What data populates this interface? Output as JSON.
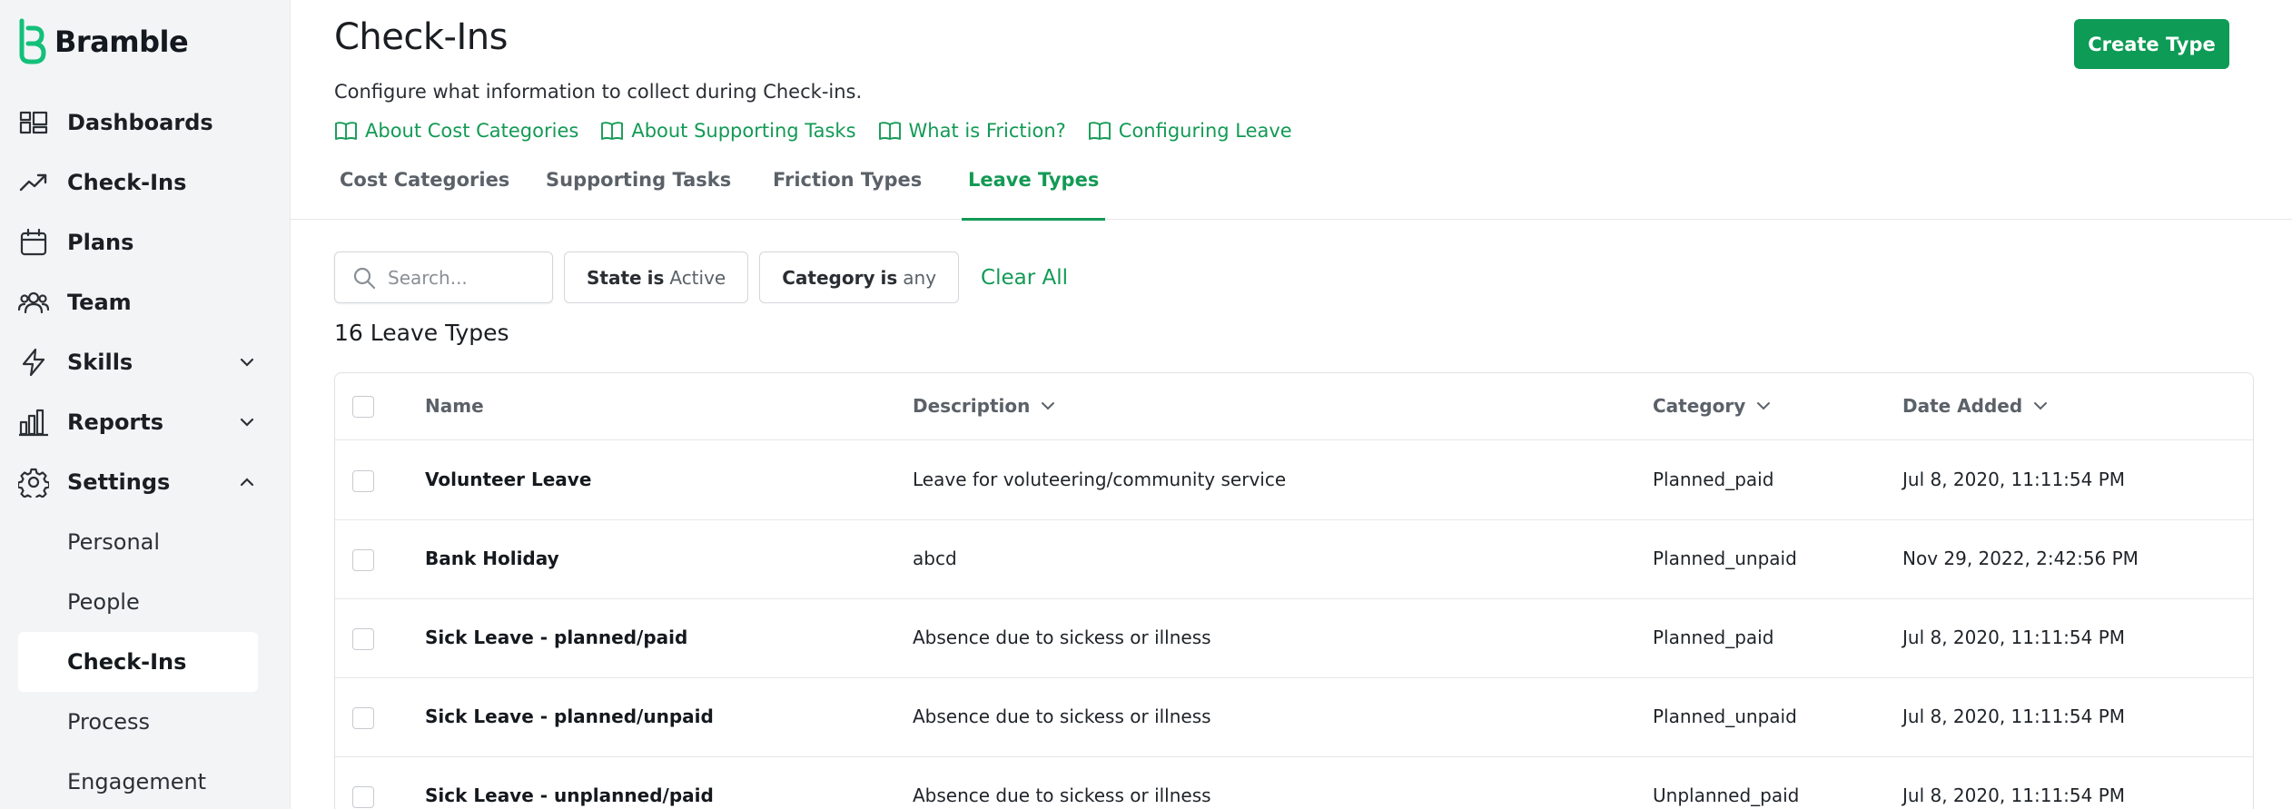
{
  "app": {
    "name": "Bramble",
    "accent": "#139a55",
    "button_color": "#0d9b55"
  },
  "sidebar": {
    "items": [
      {
        "key": "dashboards",
        "label": "Dashboards",
        "icon": "dashboard-icon"
      },
      {
        "key": "check-ins",
        "label": "Check-Ins",
        "icon": "trending-up-icon"
      },
      {
        "key": "plans",
        "label": "Plans",
        "icon": "calendar-icon"
      },
      {
        "key": "team",
        "label": "Team",
        "icon": "users-icon"
      },
      {
        "key": "skills",
        "label": "Skills",
        "icon": "lightning-icon",
        "chevron": "down"
      },
      {
        "key": "reports",
        "label": "Reports",
        "icon": "bar-chart-icon",
        "chevron": "down"
      },
      {
        "key": "settings",
        "label": "Settings",
        "icon": "gear-icon",
        "chevron": "up"
      }
    ],
    "settings_sub": [
      "Personal",
      "People",
      "Check-Ins",
      "Process",
      "Engagement"
    ],
    "active_sub": "Check-Ins"
  },
  "header": {
    "title": "Check-Ins",
    "subtitle": "Configure what information to collect during Check-ins.",
    "create_button": "Create Type",
    "help_links": [
      "About Cost Categories",
      "About Supporting Tasks",
      "What is Friction?",
      "Configuring Leave"
    ]
  },
  "tabs": [
    {
      "label": "Cost Categories",
      "active": false
    },
    {
      "label": "Supporting Tasks",
      "active": false
    },
    {
      "label": "Friction Types",
      "active": false
    },
    {
      "label": "Leave Types",
      "active": true
    }
  ],
  "filters": {
    "search_placeholder": "Search...",
    "state": {
      "key": "State",
      "op": "is",
      "value": "Active"
    },
    "category": {
      "key": "Category",
      "op": "is",
      "value": "any"
    },
    "clear_all": "Clear All"
  },
  "count_label": "16 Leave Types",
  "table": {
    "columns": [
      {
        "label": "Name",
        "sortable": false
      },
      {
        "label": "Description",
        "sortable": true
      },
      {
        "label": "Category",
        "sortable": true
      },
      {
        "label": "Date Added",
        "sortable": true
      }
    ],
    "rows": [
      {
        "name": "Volunteer Leave",
        "description": "Leave for voluteering/community service",
        "category": "Planned_paid",
        "date": "Jul 8, 2020, 11:11:54 PM"
      },
      {
        "name": "Bank Holiday",
        "description": "abcd",
        "category": "Planned_unpaid",
        "date": "Nov 29, 2022, 2:42:56 PM"
      },
      {
        "name": "Sick Leave - planned/paid",
        "description": "Absence due to sickess or illness",
        "category": "Planned_paid",
        "date": "Jul 8, 2020, 11:11:54 PM"
      },
      {
        "name": "Sick Leave - planned/unpaid",
        "description": "Absence due to sickess or illness",
        "category": "Planned_unpaid",
        "date": "Jul 8, 2020, 11:11:54 PM"
      },
      {
        "name": "Sick Leave - unplanned/paid",
        "description": "Absence due to sickess or illness",
        "category": "Unplanned_paid",
        "date": "Jul 8, 2020, 11:11:54 PM"
      }
    ]
  }
}
